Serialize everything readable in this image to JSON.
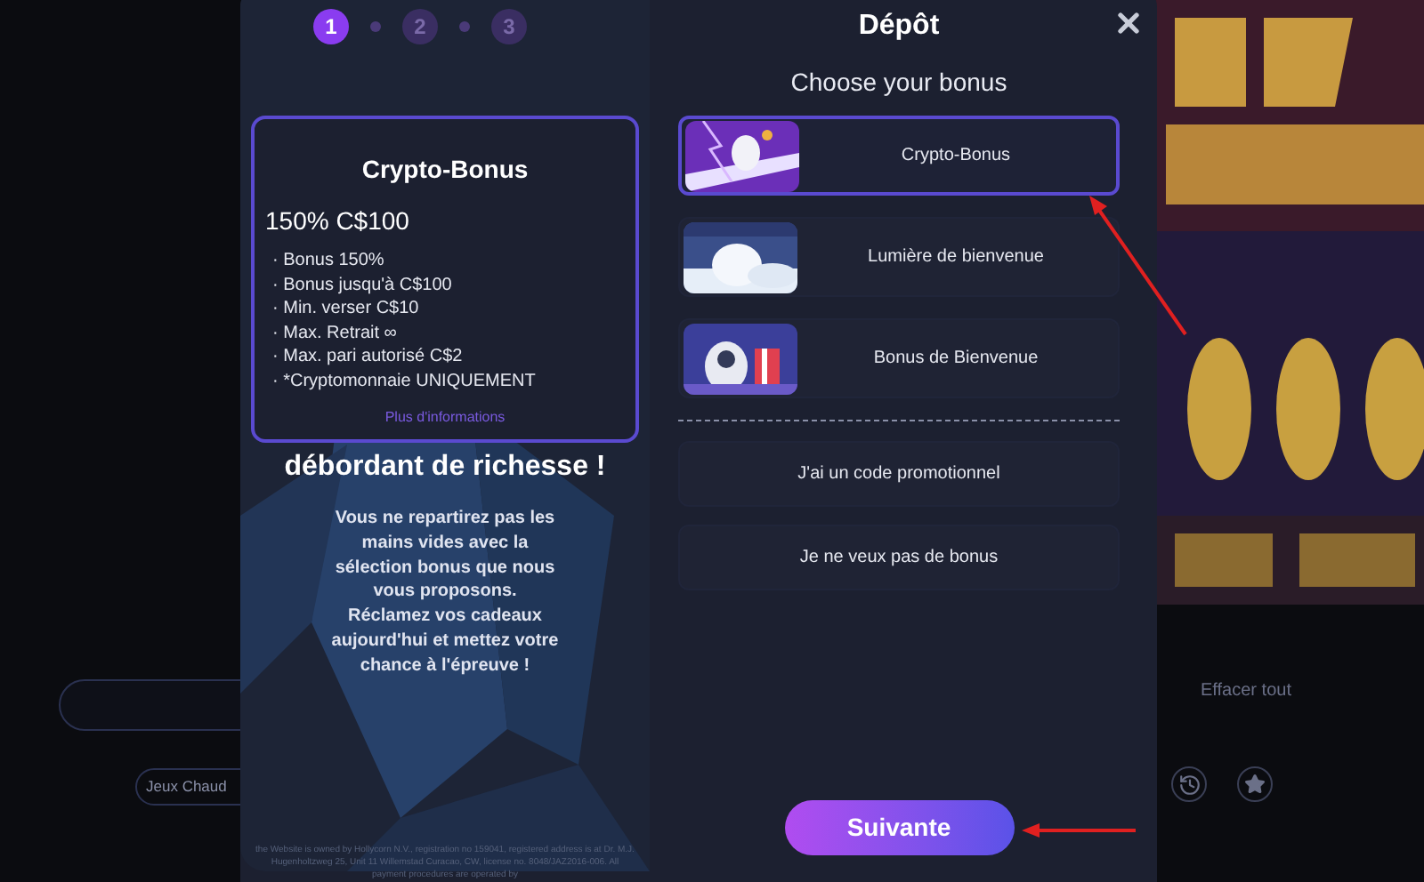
{
  "background": {
    "hot_games_button": "Jeux Chaud",
    "clear_all": "Effacer tout"
  },
  "modal": {
    "steps": [
      {
        "label": "1",
        "selected": true
      },
      {
        "label": "2",
        "selected": false
      },
      {
        "label": "3",
        "selected": false
      }
    ],
    "title": "Dépôt",
    "promo": {
      "card": {
        "title": "Crypto-Bonus",
        "amount": "150% C$100",
        "terms": [
          "· Bonus 150%",
          "· Bonus jusqu'à C$100",
          "· Min. verser C$10",
          "· Max. Retrait ∞",
          "· Max. pari autorisé C$2",
          "· *Cryptomonnaie UNIQUEMENT"
        ],
        "more_link": "Plus d'informations"
      },
      "headline": "débordant de richesse !",
      "body": "Vous ne repartirez pas les mains vides avec la sélection bonus que nous vous proposons. Réclamez vos cadeaux aujourd'hui et mettez votre chance à l'épreuve !",
      "legal": "the Website is owned by Hollycorn N.V., registration no 159041, registered address is at Dr. M.J. Hugenholtzweg 25, Unit 11 Willemstad Curacao, CW, license no. 8048/JAZ2016-006. All payment procedures are operated by"
    },
    "bonus_heading": "Choose your bonus",
    "bonuses": [
      {
        "label": "Crypto-Bonus",
        "selected": true
      },
      {
        "label": "Lumière de bienvenue",
        "selected": false
      },
      {
        "label": "Bonus de Bienvenue",
        "selected": false
      }
    ],
    "options": [
      "J'ai un code promotionnel",
      "Je ne veux pas de bonus"
    ],
    "next_button": "Suivante"
  }
}
